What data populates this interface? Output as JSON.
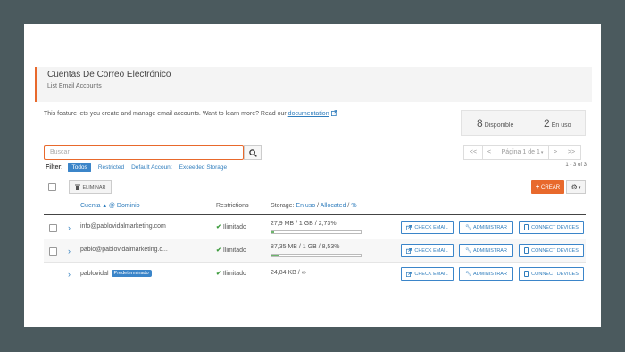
{
  "header": {
    "title": "Cuentas De Correo Electrónico",
    "subtitle": "List Email Accounts"
  },
  "intro": {
    "text": "This feature lets you create and manage email accounts. Want to learn more? Read our ",
    "link": "documentation"
  },
  "stats": {
    "available_count": "8",
    "available_label": "Disponible",
    "used_count": "2",
    "used_label": "En uso"
  },
  "search": {
    "placeholder": "Buscar"
  },
  "pagination": {
    "first": "<<",
    "prev": "<",
    "page_label": "Página 1 de 1",
    "next": ">",
    "last": ">>",
    "count": "1 - 3 of 3"
  },
  "filters": {
    "label": "Filter:",
    "options": [
      "Todos",
      "Restricted",
      "Default Account",
      "Exceeded Storage"
    ]
  },
  "toolbar": {
    "delete_label": "ELIMINAR",
    "create_label": "CREAR"
  },
  "table": {
    "headers": {
      "account": "Cuenta",
      "domain": "@ Dominio",
      "restrictions": "Restrictions",
      "storage_prefix": "Storage:",
      "storage_used": "En uso",
      "storage_allocated": "Allocated",
      "storage_percent": "%"
    },
    "rows": [
      {
        "email": "info@pablovidalmarketing.com",
        "restriction": "Ilimitado",
        "storage": "27,9 MB / 1 GB / 2,73%",
        "usage_fraction": 0.0273,
        "check_email": "CHECK EMAIL",
        "administrar": "ADMINISTRAR",
        "connect": "CONNECT DEVICES"
      },
      {
        "email": "pablo@pablovidalmarketing.c...",
        "restriction": "Ilimitado",
        "storage": "87,35 MB / 1 GB / 8,53%",
        "usage_fraction": 0.0853,
        "check_email": "CHECK EMAIL",
        "administrar": "ADMINISTRAR",
        "connect": "CONNECT DEVICES"
      },
      {
        "email": "pablovidal",
        "badge": "Predeterminado",
        "restriction": "Ilimitado",
        "storage": "24,84 KB / ∞",
        "check_email": "CHECK EMAIL",
        "administrar": "ADMINISTRAR",
        "connect": "CONNECT DEVICES"
      }
    ]
  },
  "colors": {
    "accent": "#e8692c",
    "link": "#2f7dbd",
    "success": "#3c9b3c",
    "background": "#4b5a5e"
  }
}
